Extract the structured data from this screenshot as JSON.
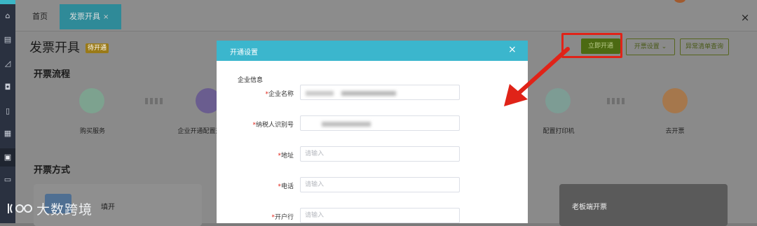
{
  "tabs": {
    "home": "首页",
    "active": "发票开具",
    "close_symbol": "×"
  },
  "window": {
    "close_all": "×"
  },
  "page": {
    "title": "发票开具",
    "status_badge": "待开通"
  },
  "actions": {
    "open_now": "立即开通",
    "invoice_settings": "开票设置",
    "abnormal_query": "异常清单查询"
  },
  "process": {
    "title": "开票流程",
    "steps": [
      {
        "label": "购买服务",
        "icon": "heart-shield-icon"
      },
      {
        "label": "企业开通配置开",
        "icon": "config-icon"
      },
      {
        "label": "配置打印机",
        "icon": "printer-icon"
      },
      {
        "label": "去开票",
        "icon": "invoice-icon"
      }
    ]
  },
  "methods": {
    "title": "开票方式",
    "card_left": "填开",
    "card_right": "老板端开票"
  },
  "modal": {
    "title": "开通设置",
    "close": "×",
    "group": "企业信息",
    "fields": [
      {
        "label": "企业名称",
        "value": "",
        "placeholder": ""
      },
      {
        "label": "纳税人识别号",
        "value": "",
        "placeholder": ""
      },
      {
        "label": "地址",
        "value": "",
        "placeholder": "请输入"
      },
      {
        "label": "电话",
        "value": "",
        "placeholder": "请输入"
      },
      {
        "label": "开户行",
        "value": "",
        "placeholder": "请输入"
      }
    ],
    "required_mark": "*"
  },
  "watermark": {
    "text": "大数跨境"
  },
  "colors": {
    "accent": "#3bb6cd",
    "highlight": "#e02318",
    "primary_button": "#4c6a12"
  }
}
